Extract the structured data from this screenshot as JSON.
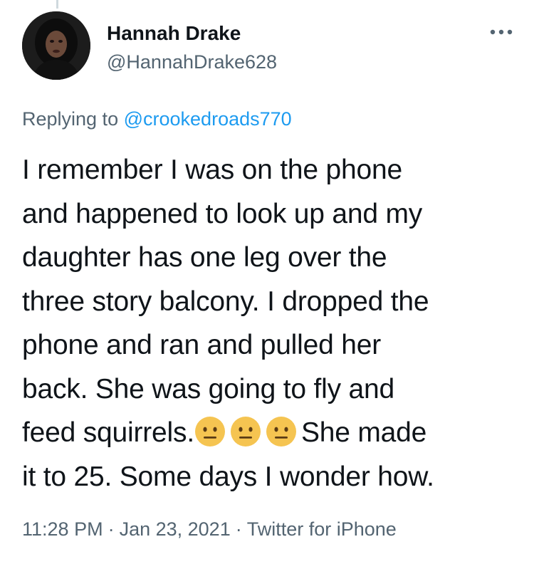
{
  "author": {
    "name": "Hannah Drake",
    "handle": "@HannahDrake628",
    "avatar_icon": "profile-photo"
  },
  "more_icon": "more-horizontal-icon",
  "reply": {
    "prefix": "Replying to",
    "mention": "@crookedroads770"
  },
  "tweet": {
    "lines": [
      "I remember I was on the phone",
      "and happened to look up and my",
      "daughter has one leg over the",
      "three story balcony. I dropped the",
      "phone and ran and pulled her",
      "back. She was going to fly and",
      "feed squirrels.",
      "She made",
      "it to 25. Some days I wonder how."
    ],
    "emoji": [
      "😐",
      "😐",
      "😐"
    ],
    "emoji_icon": "neutral-face-emoji"
  },
  "meta": {
    "time": "11:28 PM",
    "separator": "·",
    "date": "Jan 23, 2021",
    "source": "Twitter for iPhone"
  },
  "colors": {
    "text": "#0f1419",
    "secondary": "#536471",
    "link": "#1d9bf0",
    "emoji_face": "#f5c451"
  }
}
